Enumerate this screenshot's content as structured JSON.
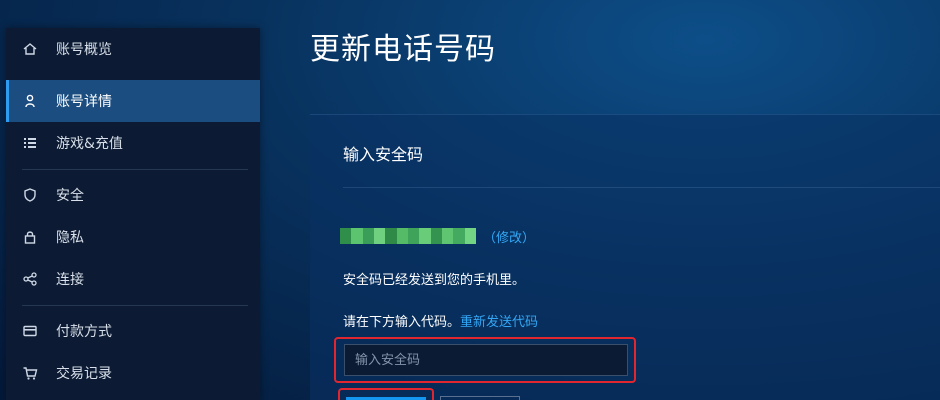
{
  "sidebar": {
    "items": [
      {
        "label": "账号概览",
        "icon": "home-icon"
      },
      {
        "label": "账号详情",
        "icon": "user-icon",
        "active": true
      },
      {
        "label": "游戏&充值",
        "icon": "list-icon"
      },
      {
        "label": "安全",
        "icon": "shield-icon"
      },
      {
        "label": "隐私",
        "icon": "lock-icon"
      },
      {
        "label": "连接",
        "icon": "share-icon"
      },
      {
        "label": "付款方式",
        "icon": "credit-card-icon"
      },
      {
        "label": "交易记录",
        "icon": "cart-icon"
      }
    ]
  },
  "main": {
    "title": "更新电话号码",
    "section_title": "输入安全码",
    "modify_link": "（修改）",
    "sent_message": "安全码已经发送到您的手机里。",
    "enter_prompt": "请在下方输入代码。",
    "resend_link": "重新发送代码",
    "code_input": {
      "placeholder": "输入安全码",
      "value": ""
    }
  },
  "colors": {
    "accent": "#2e9cf0",
    "link": "#33a7f5",
    "highlight_border": "#e0262f",
    "sidebar_bg": "#0c1b33",
    "active_item_bg": "#1b4d80"
  }
}
